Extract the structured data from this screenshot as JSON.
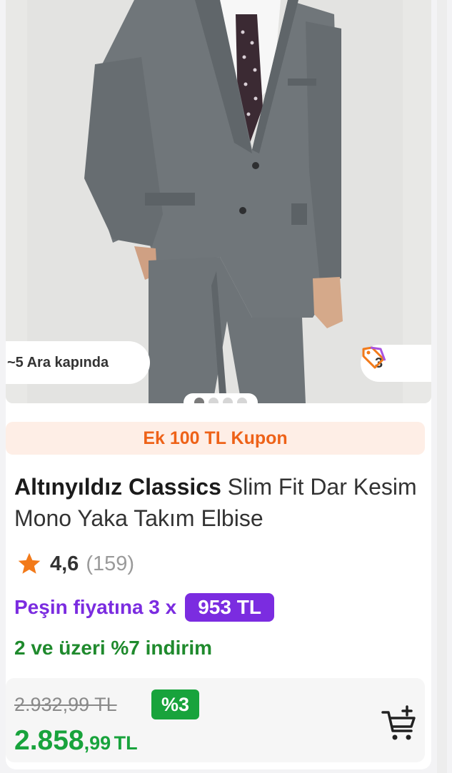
{
  "product_image": {
    "description_icon": "suit-photo"
  },
  "badges": {
    "delivery": "~5 Ara kapında",
    "tag_icon": "price-tag-icon",
    "tag_count": "3"
  },
  "carousel": {
    "count": 4,
    "active": 1
  },
  "coupon": "Ek 100 TL Kupon",
  "title": {
    "brand": "Altınyıldız Classics",
    "name": "Slim Fit Dar Kesim Mono Yaka Takım Elbise"
  },
  "rating": {
    "score": "4,6",
    "count": "(159)"
  },
  "installment": {
    "text": "Peşin fiyatına 3 x",
    "amount": "953 TL"
  },
  "promo": "2 ve üzeri %7 indirim",
  "price": {
    "old": "2.932,99 TL",
    "discount": "%3",
    "new_int": "2.858",
    "new_dec": ",99",
    "currency": "TL"
  },
  "colors": {
    "accent_orange": "#ee6218",
    "installment_purple": "#7b2ce0",
    "price_green": "#18a33c",
    "promo_green": "#1f8a2d",
    "star": "#f27a1a"
  },
  "icons": [
    "star-icon",
    "price-tag-icon",
    "add-to-cart-icon"
  ]
}
